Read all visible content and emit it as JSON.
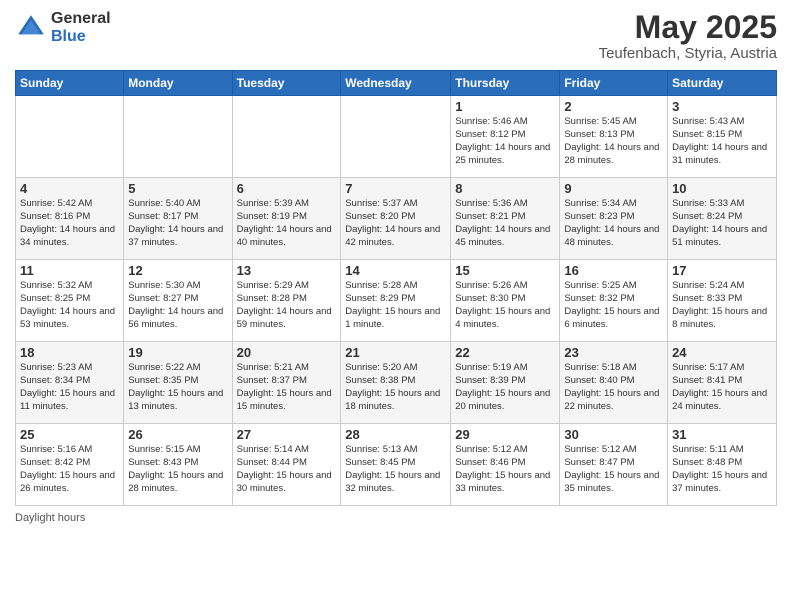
{
  "logo": {
    "general": "General",
    "blue": "Blue"
  },
  "title": {
    "month": "May 2025",
    "location": "Teufenbach, Styria, Austria"
  },
  "weekdays": [
    "Sunday",
    "Monday",
    "Tuesday",
    "Wednesday",
    "Thursday",
    "Friday",
    "Saturday"
  ],
  "weeks": [
    [
      {
        "num": "",
        "info": ""
      },
      {
        "num": "",
        "info": ""
      },
      {
        "num": "",
        "info": ""
      },
      {
        "num": "",
        "info": ""
      },
      {
        "num": "1",
        "info": "Sunrise: 5:46 AM\nSunset: 8:12 PM\nDaylight: 14 hours\nand 25 minutes."
      },
      {
        "num": "2",
        "info": "Sunrise: 5:45 AM\nSunset: 8:13 PM\nDaylight: 14 hours\nand 28 minutes."
      },
      {
        "num": "3",
        "info": "Sunrise: 5:43 AM\nSunset: 8:15 PM\nDaylight: 14 hours\nand 31 minutes."
      }
    ],
    [
      {
        "num": "4",
        "info": "Sunrise: 5:42 AM\nSunset: 8:16 PM\nDaylight: 14 hours\nand 34 minutes."
      },
      {
        "num": "5",
        "info": "Sunrise: 5:40 AM\nSunset: 8:17 PM\nDaylight: 14 hours\nand 37 minutes."
      },
      {
        "num": "6",
        "info": "Sunrise: 5:39 AM\nSunset: 8:19 PM\nDaylight: 14 hours\nand 40 minutes."
      },
      {
        "num": "7",
        "info": "Sunrise: 5:37 AM\nSunset: 8:20 PM\nDaylight: 14 hours\nand 42 minutes."
      },
      {
        "num": "8",
        "info": "Sunrise: 5:36 AM\nSunset: 8:21 PM\nDaylight: 14 hours\nand 45 minutes."
      },
      {
        "num": "9",
        "info": "Sunrise: 5:34 AM\nSunset: 8:23 PM\nDaylight: 14 hours\nand 48 minutes."
      },
      {
        "num": "10",
        "info": "Sunrise: 5:33 AM\nSunset: 8:24 PM\nDaylight: 14 hours\nand 51 minutes."
      }
    ],
    [
      {
        "num": "11",
        "info": "Sunrise: 5:32 AM\nSunset: 8:25 PM\nDaylight: 14 hours\nand 53 minutes."
      },
      {
        "num": "12",
        "info": "Sunrise: 5:30 AM\nSunset: 8:27 PM\nDaylight: 14 hours\nand 56 minutes."
      },
      {
        "num": "13",
        "info": "Sunrise: 5:29 AM\nSunset: 8:28 PM\nDaylight: 14 hours\nand 59 minutes."
      },
      {
        "num": "14",
        "info": "Sunrise: 5:28 AM\nSunset: 8:29 PM\nDaylight: 15 hours\nand 1 minute."
      },
      {
        "num": "15",
        "info": "Sunrise: 5:26 AM\nSunset: 8:30 PM\nDaylight: 15 hours\nand 4 minutes."
      },
      {
        "num": "16",
        "info": "Sunrise: 5:25 AM\nSunset: 8:32 PM\nDaylight: 15 hours\nand 6 minutes."
      },
      {
        "num": "17",
        "info": "Sunrise: 5:24 AM\nSunset: 8:33 PM\nDaylight: 15 hours\nand 8 minutes."
      }
    ],
    [
      {
        "num": "18",
        "info": "Sunrise: 5:23 AM\nSunset: 8:34 PM\nDaylight: 15 hours\nand 11 minutes."
      },
      {
        "num": "19",
        "info": "Sunrise: 5:22 AM\nSunset: 8:35 PM\nDaylight: 15 hours\nand 13 minutes."
      },
      {
        "num": "20",
        "info": "Sunrise: 5:21 AM\nSunset: 8:37 PM\nDaylight: 15 hours\nand 15 minutes."
      },
      {
        "num": "21",
        "info": "Sunrise: 5:20 AM\nSunset: 8:38 PM\nDaylight: 15 hours\nand 18 minutes."
      },
      {
        "num": "22",
        "info": "Sunrise: 5:19 AM\nSunset: 8:39 PM\nDaylight: 15 hours\nand 20 minutes."
      },
      {
        "num": "23",
        "info": "Sunrise: 5:18 AM\nSunset: 8:40 PM\nDaylight: 15 hours\nand 22 minutes."
      },
      {
        "num": "24",
        "info": "Sunrise: 5:17 AM\nSunset: 8:41 PM\nDaylight: 15 hours\nand 24 minutes."
      }
    ],
    [
      {
        "num": "25",
        "info": "Sunrise: 5:16 AM\nSunset: 8:42 PM\nDaylight: 15 hours\nand 26 minutes."
      },
      {
        "num": "26",
        "info": "Sunrise: 5:15 AM\nSunset: 8:43 PM\nDaylight: 15 hours\nand 28 minutes."
      },
      {
        "num": "27",
        "info": "Sunrise: 5:14 AM\nSunset: 8:44 PM\nDaylight: 15 hours\nand 30 minutes."
      },
      {
        "num": "28",
        "info": "Sunrise: 5:13 AM\nSunset: 8:45 PM\nDaylight: 15 hours\nand 32 minutes."
      },
      {
        "num": "29",
        "info": "Sunrise: 5:12 AM\nSunset: 8:46 PM\nDaylight: 15 hours\nand 33 minutes."
      },
      {
        "num": "30",
        "info": "Sunrise: 5:12 AM\nSunset: 8:47 PM\nDaylight: 15 hours\nand 35 minutes."
      },
      {
        "num": "31",
        "info": "Sunrise: 5:11 AM\nSunset: 8:48 PM\nDaylight: 15 hours\nand 37 minutes."
      }
    ]
  ],
  "footer": {
    "label": "Daylight hours"
  }
}
